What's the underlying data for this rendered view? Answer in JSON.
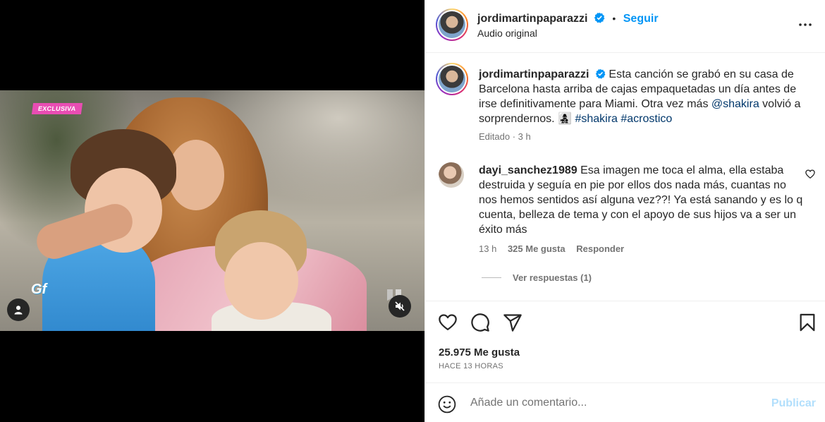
{
  "video": {
    "exclusive_badge": "EXCLUSIVA",
    "channel_logo": "Gf",
    "icons": {
      "person": "person-icon",
      "mute": "speaker-muted-icon"
    }
  },
  "header": {
    "username": "jordimartinpaparazzi",
    "separator": "•",
    "follow_label": "Seguir",
    "audio_label": "Audio original",
    "more_icon": "more-options-icon"
  },
  "caption": {
    "username": "jordimartinpaparazzi",
    "text": "Esta canción se grabó en su casa de Barcelona hasta arriba de cajas empaquetadas un día antes de irse definitivamente para Miami. Otra vez más ",
    "mention": "@shakira",
    "text2": " volvió a sorprendernos. ",
    "emoji": "👩‍👧‍👦",
    "hashtag1": "#shakira",
    "hashtag2": "#acrostico",
    "meta": "Editado · 3 h"
  },
  "comment": {
    "username": "dayi_sanchez1989",
    "text": "Esa imagen me toca el alma, ella estaba destruida y seguía en pie por ellos dos nada más, cuantas no nos hemos sentidos así alguna vez??! Ya está sanando y es lo q cuenta, belleza de tema y con el apoyo de sus hijos va a ser un éxito más",
    "time": "13 h",
    "likes": "325 Me gusta",
    "reply_label": "Responder",
    "view_replies": "Ver respuestas (1)"
  },
  "actions": {
    "icons": [
      "heart-icon",
      "comment-icon",
      "share-icon",
      "bookmark-icon"
    ]
  },
  "stats": {
    "likes": "25.975 Me gusta",
    "timestamp": "HACE 13 HORAS"
  },
  "composer": {
    "placeholder": "Añade un comentario...",
    "publish_label": "Publicar"
  },
  "colors": {
    "accent": "#0095f6",
    "link": "#00376b",
    "publish_disabled": "#b2dffc",
    "muted_text": "#737373"
  }
}
